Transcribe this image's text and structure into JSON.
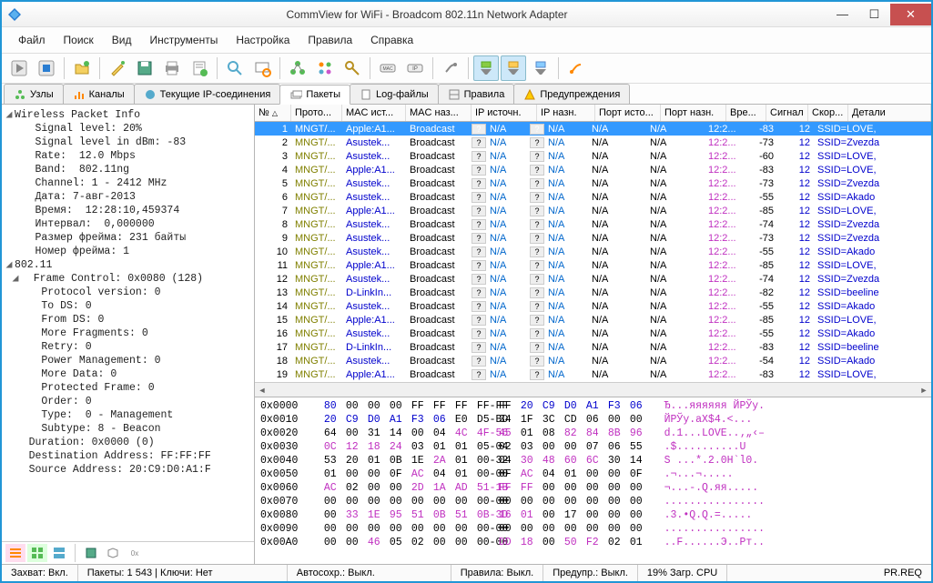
{
  "window": {
    "title": "CommView for WiFi - Broadcom 802.11n Network Adapter"
  },
  "menu": [
    "Файл",
    "Поиск",
    "Вид",
    "Инструменты",
    "Настройка",
    "Правила",
    "Справка"
  ],
  "tabs": [
    {
      "icon": "nodes",
      "label": "Узлы"
    },
    {
      "icon": "channels",
      "label": "Каналы"
    },
    {
      "icon": "ip",
      "label": "Текущие IP-соединения"
    },
    {
      "icon": "packets",
      "label": "Пакеты",
      "active": true
    },
    {
      "icon": "log",
      "label": "Log-файлы"
    },
    {
      "icon": "rules",
      "label": "Правила"
    },
    {
      "icon": "alerts",
      "label": "Предупреждения"
    }
  ],
  "tree": {
    "header": "Wireless Packet Info",
    "rows": [
      "   Signal level: 20%",
      "   Signal level in dBm: -83",
      "   Rate:  12.0 Mbps",
      "   Band:  802.11ng",
      "   Channel: 1 - 2412 MHz",
      "   Дата: 7-авг-2013",
      "   Время:  12:28:10,459374",
      "   Интервал:  0,000000",
      "   Размер фрейма: 231 байты",
      "   Номер фрейма: 1"
    ],
    "header2": "802.11",
    "rows2": [
      "  Frame Control: 0x0080 (128)",
      "     Protocol version: 0",
      "     To DS: 0",
      "     From DS: 0",
      "     More Fragments: 0",
      "     Retry: 0",
      "     Power Management: 0",
      "     More Data: 0",
      "     Protected Frame: 0",
      "     Order: 0",
      "     Type:  0 - Management",
      "     Subtype: 8 - Beacon",
      "   Duration: 0x0000 (0)",
      "   Destination Address: FF:FF:FF",
      "   Source Address: 20:C9:D0:A1:F"
    ]
  },
  "columns": [
    "№",
    "Прото...",
    "MAC ист...",
    "MAC наз...",
    "IP источн.",
    "IP назн.",
    "Порт исто...",
    "Порт назн.",
    "Вре...",
    "Сигнал",
    "Скор...",
    "Детали"
  ],
  "packets": [
    {
      "no": 1,
      "proto": "MNGT/...",
      "msrc": "Apple:A1...",
      "mdst": "Broadcast",
      "ips": "N/A",
      "ipd": "N/A",
      "ps": "N/A",
      "pd": "N/A",
      "time": "12:2...",
      "sig": -83,
      "rate": 12,
      "det": "SSID=LOVE,",
      "sel": true
    },
    {
      "no": 2,
      "proto": "MNGT/...",
      "msrc": "Asustek...",
      "mdst": "Broadcast",
      "ips": "N/A",
      "ipd": "N/A",
      "ps": "N/A",
      "pd": "N/A",
      "time": "12:2...",
      "sig": -73,
      "rate": 12,
      "det": "SSID=Zvezda"
    },
    {
      "no": 3,
      "proto": "MNGT/...",
      "msrc": "Asustek...",
      "mdst": "Broadcast",
      "ips": "N/A",
      "ipd": "N/A",
      "ps": "N/A",
      "pd": "N/A",
      "time": "12:2...",
      "sig": -60,
      "rate": 12,
      "det": "SSID=LOVE,"
    },
    {
      "no": 4,
      "proto": "MNGT/...",
      "msrc": "Apple:A1...",
      "mdst": "Broadcast",
      "ips": "N/A",
      "ipd": "N/A",
      "ps": "N/A",
      "pd": "N/A",
      "time": "12:2...",
      "sig": -83,
      "rate": 12,
      "det": "SSID=LOVE,"
    },
    {
      "no": 5,
      "proto": "MNGT/...",
      "msrc": "Asustek...",
      "mdst": "Broadcast",
      "ips": "N/A",
      "ipd": "N/A",
      "ps": "N/A",
      "pd": "N/A",
      "time": "12:2...",
      "sig": -73,
      "rate": 12,
      "det": "SSID=Zvezda"
    },
    {
      "no": 6,
      "proto": "MNGT/...",
      "msrc": "Asustek...",
      "mdst": "Broadcast",
      "ips": "N/A",
      "ipd": "N/A",
      "ps": "N/A",
      "pd": "N/A",
      "time": "12:2...",
      "sig": -55,
      "rate": 12,
      "det": "SSID=Akado"
    },
    {
      "no": 7,
      "proto": "MNGT/...",
      "msrc": "Apple:A1...",
      "mdst": "Broadcast",
      "ips": "N/A",
      "ipd": "N/A",
      "ps": "N/A",
      "pd": "N/A",
      "time": "12:2...",
      "sig": -85,
      "rate": 12,
      "det": "SSID=LOVE,"
    },
    {
      "no": 8,
      "proto": "MNGT/...",
      "msrc": "Asustek...",
      "mdst": "Broadcast",
      "ips": "N/A",
      "ipd": "N/A",
      "ps": "N/A",
      "pd": "N/A",
      "time": "12:2...",
      "sig": -74,
      "rate": 12,
      "det": "SSID=Zvezda"
    },
    {
      "no": 9,
      "proto": "MNGT/...",
      "msrc": "Asustek...",
      "mdst": "Broadcast",
      "ips": "N/A",
      "ipd": "N/A",
      "ps": "N/A",
      "pd": "N/A",
      "time": "12:2...",
      "sig": -73,
      "rate": 12,
      "det": "SSID=Zvezda"
    },
    {
      "no": 10,
      "proto": "MNGT/...",
      "msrc": "Asustek...",
      "mdst": "Broadcast",
      "ips": "N/A",
      "ipd": "N/A",
      "ps": "N/A",
      "pd": "N/A",
      "time": "12:2...",
      "sig": -55,
      "rate": 12,
      "det": "SSID=Akado"
    },
    {
      "no": 11,
      "proto": "MNGT/...",
      "msrc": "Apple:A1...",
      "mdst": "Broadcast",
      "ips": "N/A",
      "ipd": "N/A",
      "ps": "N/A",
      "pd": "N/A",
      "time": "12:2...",
      "sig": -85,
      "rate": 12,
      "det": "SSID=LOVE,"
    },
    {
      "no": 12,
      "proto": "MNGT/...",
      "msrc": "Asustek...",
      "mdst": "Broadcast",
      "ips": "N/A",
      "ipd": "N/A",
      "ps": "N/A",
      "pd": "N/A",
      "time": "12:2...",
      "sig": -74,
      "rate": 12,
      "det": "SSID=Zvezda"
    },
    {
      "no": 13,
      "proto": "MNGT/...",
      "msrc": "D-LinkIn...",
      "mdst": "Broadcast",
      "ips": "N/A",
      "ipd": "N/A",
      "ps": "N/A",
      "pd": "N/A",
      "time": "12:2...",
      "sig": -82,
      "rate": 12,
      "det": "SSID=beeline"
    },
    {
      "no": 14,
      "proto": "MNGT/...",
      "msrc": "Asustek...",
      "mdst": "Broadcast",
      "ips": "N/A",
      "ipd": "N/A",
      "ps": "N/A",
      "pd": "N/A",
      "time": "12:2...",
      "sig": -55,
      "rate": 12,
      "det": "SSID=Akado"
    },
    {
      "no": 15,
      "proto": "MNGT/...",
      "msrc": "Apple:A1...",
      "mdst": "Broadcast",
      "ips": "N/A",
      "ipd": "N/A",
      "ps": "N/A",
      "pd": "N/A",
      "time": "12:2...",
      "sig": -85,
      "rate": 12,
      "det": "SSID=LOVE,"
    },
    {
      "no": 16,
      "proto": "MNGT/...",
      "msrc": "Asustek...",
      "mdst": "Broadcast",
      "ips": "N/A",
      "ipd": "N/A",
      "ps": "N/A",
      "pd": "N/A",
      "time": "12:2...",
      "sig": -55,
      "rate": 12,
      "det": "SSID=Akado"
    },
    {
      "no": 17,
      "proto": "MNGT/...",
      "msrc": "D-LinkIn...",
      "mdst": "Broadcast",
      "ips": "N/A",
      "ipd": "N/A",
      "ps": "N/A",
      "pd": "N/A",
      "time": "12:2...",
      "sig": -83,
      "rate": 12,
      "det": "SSID=beeline"
    },
    {
      "no": 18,
      "proto": "MNGT/...",
      "msrc": "Asustek...",
      "mdst": "Broadcast",
      "ips": "N/A",
      "ipd": "N/A",
      "ps": "N/A",
      "pd": "N/A",
      "time": "12:2...",
      "sig": -54,
      "rate": 12,
      "det": "SSID=Akado"
    },
    {
      "no": 19,
      "proto": "MNGT/...",
      "msrc": "Apple:A1...",
      "mdst": "Broadcast",
      "ips": "N/A",
      "ipd": "N/A",
      "ps": "N/A",
      "pd": "N/A",
      "time": "12:2...",
      "sig": -83,
      "rate": 12,
      "det": "SSID=LOVE,"
    }
  ],
  "hex": [
    {
      "off": "0x0000",
      "bytes": [
        "80",
        "00",
        "00",
        "00",
        "FF",
        "FF",
        "FF",
        "FF-FF",
        "FF",
        "20",
        "C9",
        "D0",
        "A1",
        "F3",
        "06"
      ],
      "cols": [
        "b",
        "n",
        "n",
        "n",
        "n",
        "n",
        "n",
        "n",
        "n",
        "b",
        "b",
        "b",
        "b",
        "b",
        "b"
      ],
      "asc": "Ђ...яяяяяя ЙРЎу."
    },
    {
      "off": "0x0010",
      "bytes": [
        "20",
        "C9",
        "D0",
        "A1",
        "F3",
        "06",
        "E0",
        "D5-BD",
        "34",
        "1F",
        "3C",
        "CD",
        "06",
        "00",
        "00"
      ],
      "cols": [
        "b",
        "b",
        "b",
        "b",
        "b",
        "b",
        "n",
        "n",
        "n",
        "n",
        "n",
        "n",
        "n",
        "n",
        "n"
      ],
      "asc": "ЙРЎу.аX$4.<..."
    },
    {
      "off": "0x0020",
      "bytes": [
        "64",
        "00",
        "31",
        "14",
        "00",
        "04",
        "4C",
        "4F-56",
        "45",
        "01",
        "08",
        "82",
        "84",
        "8B",
        "96"
      ],
      "cols": [
        "n",
        "n",
        "n",
        "n",
        "n",
        "n",
        "m",
        "m",
        "m",
        "n",
        "n",
        "m",
        "m",
        "m",
        "m"
      ],
      "asc": "d.1...LOVE..‚„‹–"
    },
    {
      "off": "0x0030",
      "bytes": [
        "0C",
        "12",
        "18",
        "24",
        "03",
        "01",
        "01",
        "05-04",
        "02",
        "03",
        "00",
        "00",
        "07",
        "06",
        "55"
      ],
      "cols": [
        "m",
        "m",
        "m",
        "m",
        "n",
        "n",
        "n",
        "n",
        "n",
        "n",
        "n",
        "n",
        "n",
        "n",
        "n"
      ],
      "asc": ".$..........U"
    },
    {
      "off": "0x0040",
      "bytes": [
        "53",
        "20",
        "01",
        "0B",
        "1E",
        "2A",
        "01",
        "00-32",
        "04",
        "30",
        "48",
        "60",
        "6C",
        "30",
        "14"
      ],
      "cols": [
        "n",
        "n",
        "n",
        "n",
        "n",
        "m",
        "n",
        "n",
        "n",
        "m",
        "m",
        "m",
        "m",
        "n",
        "n"
      ],
      "asc": "S ...*.2.0H`l0."
    },
    {
      "off": "0x0050",
      "bytes": [
        "01",
        "00",
        "00",
        "0F",
        "AC",
        "04",
        "01",
        "00-00",
        "0F",
        "AC",
        "04",
        "01",
        "00",
        "00",
        "0F"
      ],
      "cols": [
        "n",
        "n",
        "n",
        "n",
        "m",
        "n",
        "n",
        "n",
        "n",
        "m",
        "n",
        "n",
        "n",
        "n",
        "n"
      ],
      "asc": ".¬...¬....."
    },
    {
      "off": "0x0060",
      "bytes": [
        "AC",
        "02",
        "00",
        "00",
        "2D",
        "1A",
        "AD",
        "51-1B",
        "FF",
        "FF",
        "00",
        "00",
        "00",
        "00",
        "00"
      ],
      "cols": [
        "m",
        "n",
        "n",
        "n",
        "m",
        "m",
        "m",
        "m",
        "m",
        "m",
        "n",
        "n",
        "n",
        "n",
        "n"
      ],
      "asc": "¬...-.­Q.яя....."
    },
    {
      "off": "0x0070",
      "bytes": [
        "00",
        "00",
        "00",
        "00",
        "00",
        "00",
        "00",
        "00-00",
        "00",
        "00",
        "00",
        "00",
        "00",
        "00",
        "00"
      ],
      "cols": [
        "n",
        "n",
        "n",
        "n",
        "n",
        "n",
        "n",
        "n",
        "n",
        "n",
        "n",
        "n",
        "n",
        "n",
        "n"
      ],
      "asc": "................"
    },
    {
      "off": "0x0080",
      "bytes": [
        "00",
        "33",
        "1E",
        "95",
        "51",
        "0B",
        "51",
        "0B-3D",
        "16",
        "01",
        "00",
        "17",
        "00",
        "00",
        "00"
      ],
      "cols": [
        "n",
        "m",
        "m",
        "m",
        "m",
        "m",
        "m",
        "m",
        "m",
        "m",
        "n",
        "n",
        "n",
        "n",
        "n"
      ],
      "asc": ".3.•Q.Q.=....."
    },
    {
      "off": "0x0090",
      "bytes": [
        "00",
        "00",
        "00",
        "00",
        "00",
        "00",
        "00",
        "00-00",
        "00",
        "00",
        "00",
        "00",
        "00",
        "00",
        "00"
      ],
      "cols": [
        "n",
        "n",
        "n",
        "n",
        "n",
        "n",
        "n",
        "n",
        "n",
        "n",
        "n",
        "n",
        "n",
        "n",
        "n"
      ],
      "asc": "................"
    },
    {
      "off": "0x00A0",
      "bytes": [
        "00",
        "00",
        "46",
        "05",
        "02",
        "00",
        "00",
        "00-00",
        "DD",
        "18",
        "00",
        "50",
        "F2",
        "02",
        "01"
      ],
      "cols": [
        "n",
        "n",
        "m",
        "n",
        "n",
        "n",
        "n",
        "n",
        "m",
        "m",
        "n",
        "m",
        "m",
        "n",
        "n"
      ],
      "asc": "..F......Э..Pт.."
    }
  ],
  "status": {
    "capture": "Захват: Вкл.",
    "packets": "Пакеты: 1 543 | Ключи: Нет",
    "autosave": "Автосохр.: Выкл.",
    "rules": "Правила: Выкл.",
    "alerts": "Предупр.: Выкл.",
    "cpu": "19% Загр. CPU",
    "pr": "PR.REQ"
  }
}
